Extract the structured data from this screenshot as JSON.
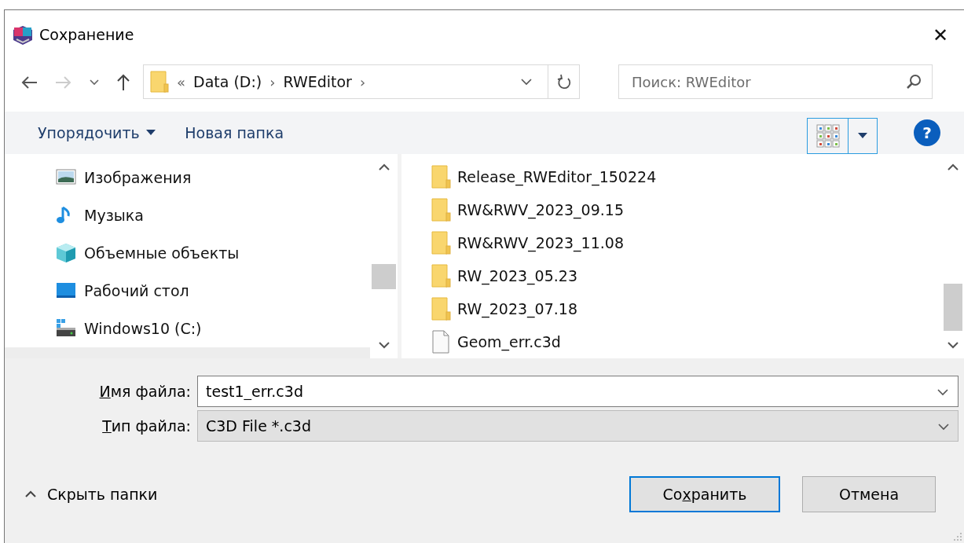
{
  "window": {
    "title": "Сохранение",
    "close": "✕"
  },
  "nav": {
    "back_enabled": true,
    "forward_enabled": false,
    "breadcrumb_lead": "«",
    "breadcrumb": [
      {
        "label": "Data (D:)"
      },
      {
        "label": "RWEditor"
      }
    ],
    "separator": "›",
    "search": {
      "placeholder": "Поиск: RWEditor"
    }
  },
  "toolbar": {
    "organize": "Упорядочить",
    "new_folder": "Новая папка",
    "help": "?"
  },
  "sidebar": {
    "items": [
      {
        "label": "Изображения",
        "kind": "pictures"
      },
      {
        "label": "Музыка",
        "kind": "music"
      },
      {
        "label": "Объемные объекты",
        "kind": "objects3d"
      },
      {
        "label": "Рабочий стол",
        "kind": "desktop"
      },
      {
        "label": "Windows10 (C:)",
        "kind": "drive"
      }
    ]
  },
  "files": [
    {
      "name": "Release_RWEditor_150224",
      "kind": "folder"
    },
    {
      "name": "RW&RWV_2023_09.15",
      "kind": "folder"
    },
    {
      "name": "RW&RWV_2023_11.08",
      "kind": "folder"
    },
    {
      "name": "RW_2023_05.23",
      "kind": "folder"
    },
    {
      "name": "RW_2023_07.18",
      "kind": "folder"
    },
    {
      "name": "Geom_err.c3d",
      "kind": "file"
    }
  ],
  "form": {
    "file_name": {
      "label": {
        "key": "И",
        "after": "мя файла:"
      },
      "value": "test1_err.c3d"
    },
    "file_type": {
      "label": {
        "key": "Т",
        "after": "ип файла:"
      },
      "value": "C3D File *.c3d"
    }
  },
  "footer": {
    "hide_folders": "Скрыть папки",
    "buttons": [
      {
        "label": {
          "before": "Со",
          "key": "х",
          "after": "ранить"
        },
        "default": true
      },
      {
        "label": {
          "after": "Отмена"
        },
        "default": false
      }
    ]
  }
}
